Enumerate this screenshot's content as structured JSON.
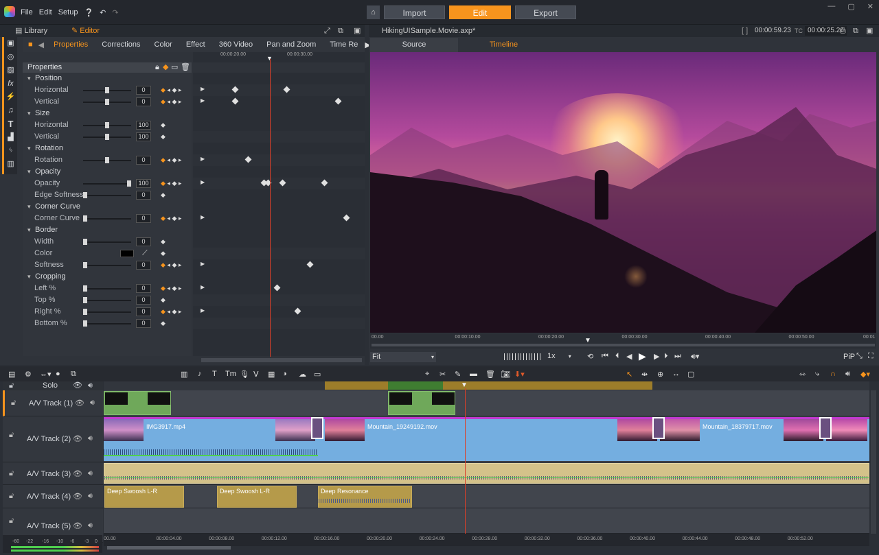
{
  "menu": {
    "file": "File",
    "edit": "Edit",
    "setup": "Setup"
  },
  "nav": {
    "import": "Import",
    "edit": "Edit",
    "export": "Export"
  },
  "left_tabs": {
    "library": "Library",
    "editor": "Editor"
  },
  "editor_tabs": [
    "Properties",
    "Corrections",
    "Color",
    "Effect",
    "360 Video",
    "Pan and Zoom",
    "Time Re"
  ],
  "key_ruler": [
    "00:00:20.00",
    "00:00:30.00"
  ],
  "properties_title": "Properties",
  "props": [
    {
      "type": "sec",
      "label": "Position"
    },
    {
      "type": "p",
      "label": "Horizontal",
      "val": "0",
      "thumb": 0.5,
      "kf": true
    },
    {
      "type": "p",
      "label": "Vertical",
      "val": "0",
      "thumb": 0.5,
      "kf": true
    },
    {
      "type": "sec",
      "label": "Size"
    },
    {
      "type": "p",
      "label": "Horizontal",
      "val": "100",
      "thumb": 0.5,
      "kf": false
    },
    {
      "type": "p",
      "label": "Vertical",
      "val": "100",
      "thumb": 0.5,
      "kf": false
    },
    {
      "type": "sec",
      "label": "Rotation"
    },
    {
      "type": "p",
      "label": "Rotation",
      "val": "0",
      "thumb": 0.5,
      "kf": true
    },
    {
      "type": "sec",
      "label": "Opacity"
    },
    {
      "type": "p",
      "label": "Opacity",
      "val": "100",
      "thumb": 1,
      "kf": true
    },
    {
      "type": "p",
      "label": "Edge Softness",
      "val": "0",
      "thumb": 0,
      "kf": false
    },
    {
      "type": "sec",
      "label": "Corner Curve"
    },
    {
      "type": "p",
      "label": "Corner Curve",
      "val": "0",
      "thumb": 0,
      "kf": true
    },
    {
      "type": "sec",
      "label": "Border"
    },
    {
      "type": "p",
      "label": "Width",
      "val": "0",
      "thumb": 0,
      "kf": false
    },
    {
      "type": "c",
      "label": "Color"
    },
    {
      "type": "p",
      "label": "Softness",
      "val": "0",
      "thumb": 0,
      "kf": true
    },
    {
      "type": "sec",
      "label": "Cropping"
    },
    {
      "type": "p",
      "label": "Left %",
      "val": "0",
      "thumb": 0,
      "kf": true
    },
    {
      "type": "p",
      "label": "Top %",
      "val": "0",
      "thumb": 0,
      "kf": false
    },
    {
      "type": "p",
      "label": "Right %",
      "val": "0",
      "thumb": 0,
      "kf": true
    },
    {
      "type": "p",
      "label": "Bottom %",
      "val": "0",
      "thumb": 0,
      "kf": false
    }
  ],
  "viewer": {
    "file": "HikingUISample.Movie.axp*",
    "duration": "00:00:59.23",
    "tc_label": "TC",
    "tc": "00:00:25.20",
    "source_tab": "Source",
    "timeline_tab": "Timeline",
    "fit": "Fit",
    "speed": "1x",
    "pip": "PiP",
    "ruler": [
      "00.00",
      "00:00:10.00",
      "00:00:20.00",
      "00:00:30.00",
      "00:00:40.00",
      "00:00:50.00",
      "00:01"
    ]
  },
  "solo": "Solo",
  "tracks": [
    {
      "name": "A/V Track (1)"
    },
    {
      "name": "A/V Track (2)"
    },
    {
      "name": "A/V Track (3)"
    },
    {
      "name": "A/V Track (4)"
    },
    {
      "name": "A/V Track (5)"
    }
  ],
  "clips": {
    "img": "IMG3917.mp4",
    "m1": "Mountain_19249192.mov",
    "m2": "Mountain_18379717.mov",
    "s1": "Deep Swoosh L-R",
    "s2": "Deep Swoosh L-R",
    "s3": "Deep Resonance"
  },
  "tl_ruler": [
    "00.00",
    "00:00:04.00",
    "00:00:08.00",
    "00:00:12.00",
    "00:00:16.00",
    "00:00:20.00",
    "00:00:24.00",
    "00:00:28.00",
    "00:00:32.00",
    "00:00:36.00",
    "00:00:40.00",
    "00:00:44.00",
    "00:00:48.00",
    "00:00:52.00"
  ],
  "meter": [
    "-60",
    "-22",
    "-16",
    "-10",
    "-6",
    "-3",
    "0"
  ]
}
